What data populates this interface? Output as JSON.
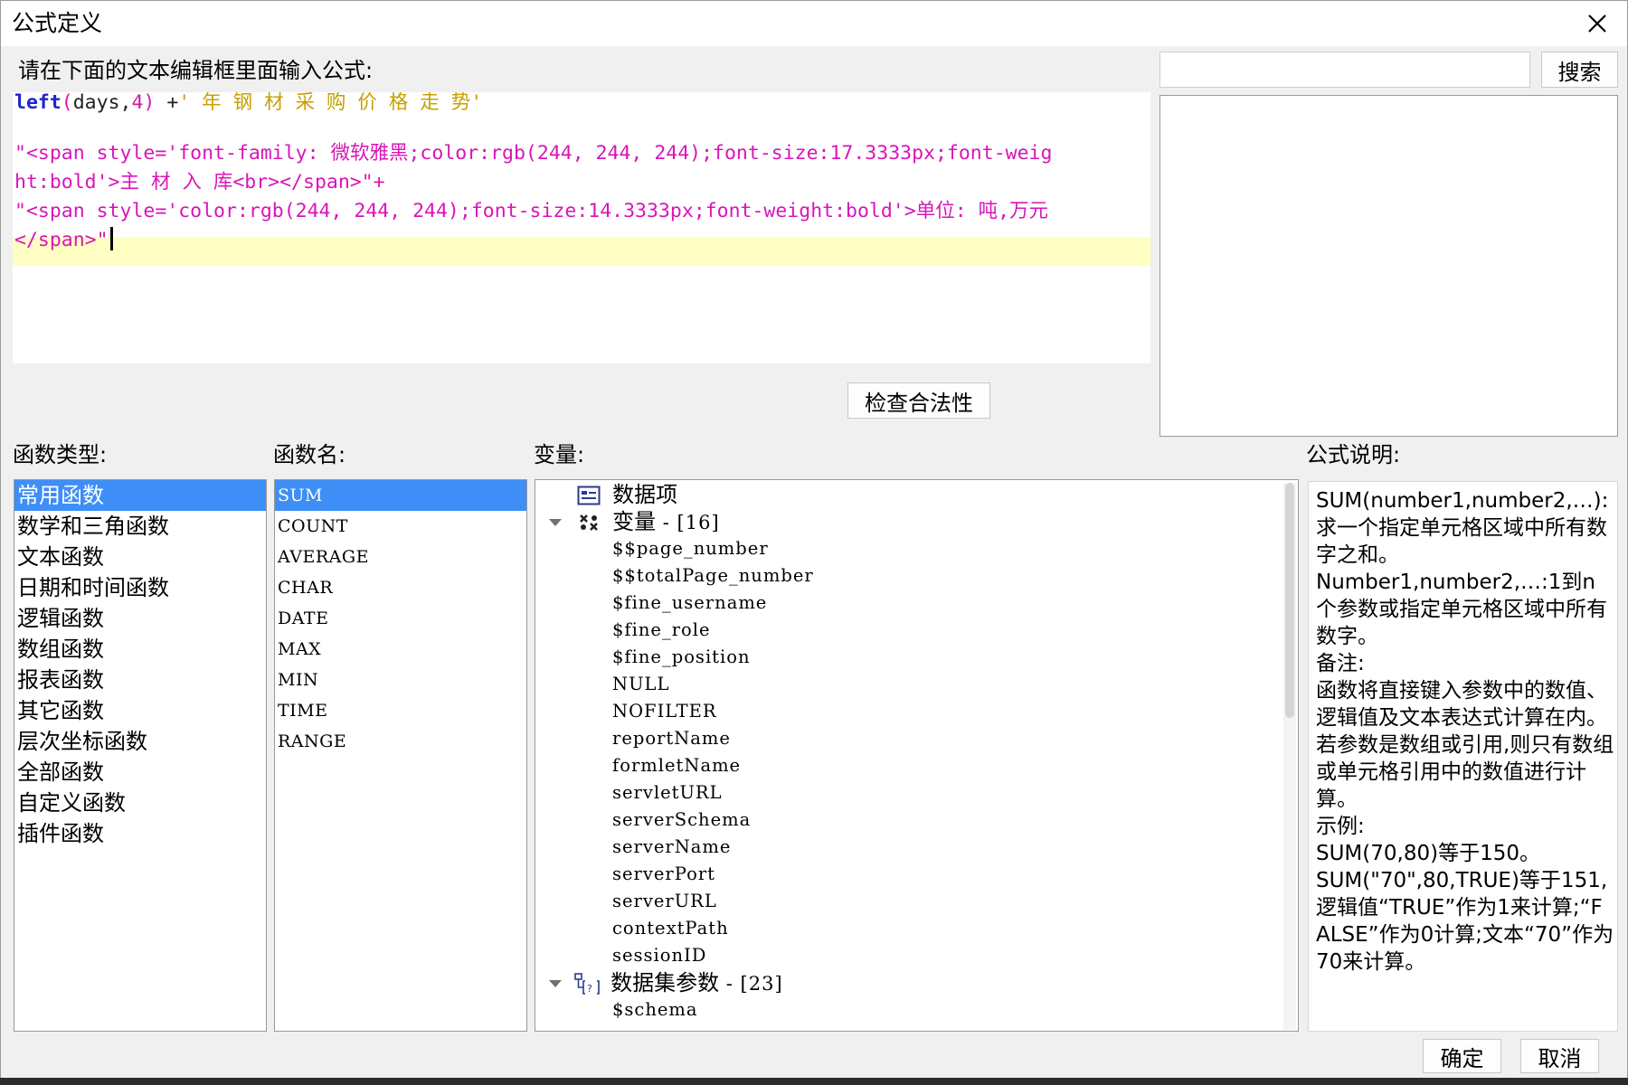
{
  "window": {
    "title": "公式定义",
    "close_icon": "close-icon"
  },
  "editor": {
    "label": "请在下面的文本编辑框里面输入公式:",
    "line1": {
      "func": "left",
      "open": "(",
      "arg": "days",
      "comma": ",",
      "num": "4",
      "close": ")",
      "plus": " +",
      "str": "' 年 钢 材 采 购 价 格 走 势'"
    },
    "line3": "\"<span style='font-family: 微软雅黑;color:rgb(244, 244, 244);font-size:17.3333px;font-weig",
    "line4": "ht:bold'>主 材 入 库<br></span>\"+",
    "line5": "\"<span style='color:rgb(244, 244, 244);font-size:14.3333px;font-weight:bold'>单位: 吨,万元",
    "line6": "</span>\""
  },
  "search": {
    "placeholder": "",
    "button_label": "搜索"
  },
  "check_button_label": "检查合法性",
  "function_types": {
    "label": "函数类型:",
    "items": [
      "常用函数",
      "数学和三角函数",
      "文本函数",
      "日期和时间函数",
      "逻辑函数",
      "数组函数",
      "报表函数",
      "其它函数",
      "层次坐标函数",
      "全部函数",
      "自定义函数",
      "插件函数"
    ],
    "selected": "常用函数"
  },
  "function_names": {
    "label": "函数名:",
    "items": [
      "SUM",
      "COUNT",
      "AVERAGE",
      "CHAR",
      "DATE",
      "MAX",
      "MIN",
      "TIME",
      "RANGE"
    ],
    "selected": "SUM"
  },
  "variables": {
    "label": "变量:",
    "data_items": "数据项",
    "vars_group": {
      "label": "变量",
      "count": " - [16]"
    },
    "var_items": [
      "$$page_number",
      "$$totalPage_number",
      "$fine_username",
      "$fine_role",
      "$fine_position",
      "NULL",
      "NOFILTER",
      "reportName",
      "formletName",
      "servletURL",
      "serverSchema",
      "serverName",
      "serverPort",
      "serverURL",
      "contextPath",
      "sessionID"
    ],
    "dataset_group": {
      "label": "数据集参数",
      "count": " - [23]"
    },
    "dataset_items": [
      "$schema"
    ]
  },
  "description": {
    "label": "公式说明:",
    "text": "SUM(number1,number2,…):求一个指定单元格区域中所有数字之和。\nNumber1,number2,…:1到n个参数或指定单元格区域中所有数字。\n备注:\n函数将直接键入参数中的数值、逻辑值及文本表达式计算在内。若参数是数组或引用,则只有数组或单元格引用中的数值进行计算。\n示例:\nSUM(70,80)等于150。\nSUM(\"70\",80,TRUE)等于151,逻辑值“TRUE”作为1来计算;“FALSE”作为0计算;文本“70”作为70来计算。"
  },
  "footer": {
    "ok_label": "确定",
    "cancel_label": "取消"
  }
}
